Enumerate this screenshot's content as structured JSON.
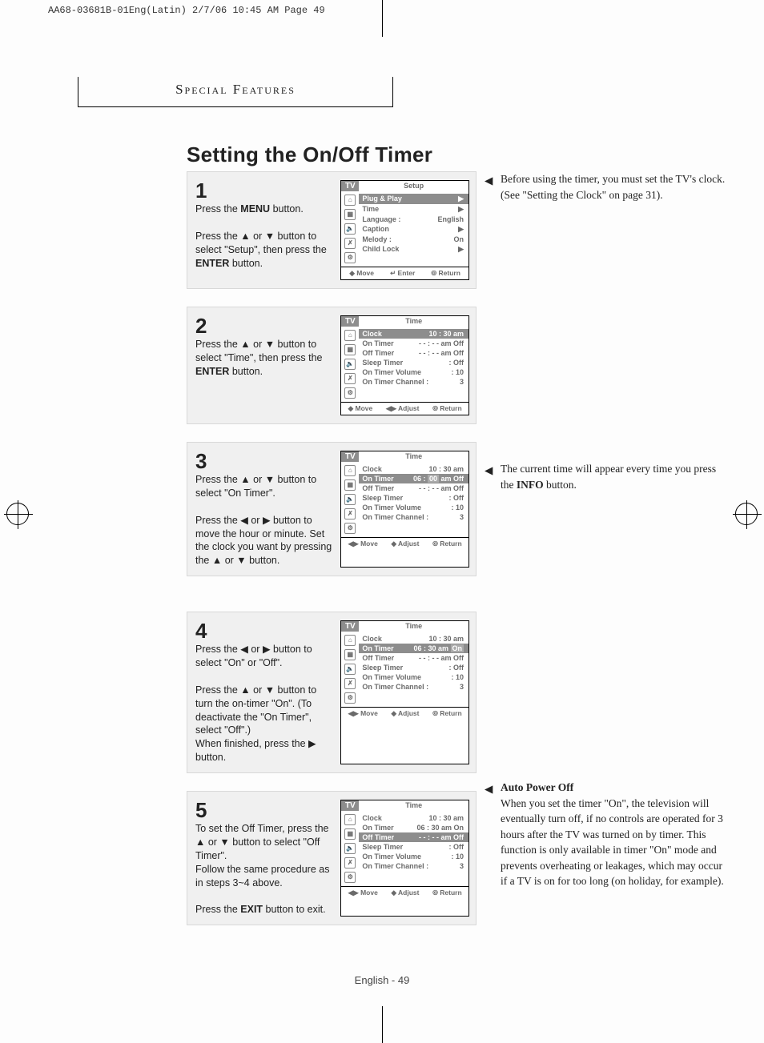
{
  "print_header": "AA68-03681B-01Eng(Latin)  2/7/06  10:45 AM  Page 49",
  "section_header": "Special Features",
  "title": "Setting the On/Off Timer",
  "footer": "English - 49",
  "tri": {
    "up": "▲",
    "down": "▼",
    "left": "◀",
    "right": "▶",
    "lr": "◀▶",
    "ud": "▲▼",
    "enter": "↵",
    "ret": "⦾"
  },
  "sidenotes": {
    "n1": "Before using the timer, you must set the TV's clock. (See \"Setting the Clock\" on page 31).",
    "n2_a": "The current time will appear every time you press the ",
    "n2_info": "INFO",
    "n2_b": " button.",
    "n3_title": "Auto Power Off",
    "n3_body": "When you set the timer \"On\", the television will eventually turn off, if no controls are operated for 3 hours after the TV was turned on by timer. This function is only available in timer \"On\" mode and prevents overheating or leakages, which may occur if a TV is on for too long (on holiday, for example)."
  },
  "steps": [
    {
      "num": "1",
      "text_a": "Press the ",
      "text_menu": "MENU",
      "text_b": " button.",
      "text_c": "Press the ▲ or ▼ button to select \"Setup\", then press the ",
      "text_enter": "ENTER",
      "text_d": " button.",
      "osd": {
        "title": "Setup",
        "foot": [
          "◆ Move",
          "↵ Enter",
          "⦾ Return"
        ],
        "rows": [
          {
            "sel": true,
            "l": "Plug & Play",
            "r": "▶"
          },
          {
            "l": "Time",
            "r": "▶"
          },
          {
            "l": "Language :",
            "r": "English"
          },
          {
            "l": "Caption",
            "r": "▶"
          },
          {
            "l": "Melody    :",
            "r": "On"
          },
          {
            "l": "Child Lock",
            "r": "▶"
          }
        ]
      }
    },
    {
      "num": "2",
      "text_a": "Press the ▲ or ▼ button to select \"Time\", then press the ",
      "text_enter": "ENTER",
      "text_b": " button.",
      "osd": {
        "title": "Time",
        "foot": [
          "◆ Move",
          "◀▶ Adjust",
          "⦾ Return"
        ],
        "rows": [
          {
            "sel": true,
            "l": "Clock",
            "r": "10 : 30 am"
          },
          {
            "l": "On Timer",
            "r": "- - : - - am Off"
          },
          {
            "l": "Off Timer",
            "r": "- - : - - am Off"
          },
          {
            "l": "Sleep Timer",
            "r": ": Off"
          },
          {
            "l": "On Timer Volume",
            "r": ": 10"
          },
          {
            "l": "On Timer Channel :",
            "r": "3"
          }
        ]
      }
    },
    {
      "num": "3",
      "text_a": "Press the ▲ or ▼ button to select \"On Timer\".",
      "text_b": "Press the ◀ or ▶ button to move the hour or minute. Set the clock you want by pressing the ▲ or ▼ button.",
      "osd": {
        "title": "Time",
        "foot": [
          "◀▶ Move",
          "◆ Adjust",
          "⦾ Return"
        ],
        "rows": [
          {
            "l": "Clock",
            "r": "10 : 30 am"
          },
          {
            "sel": true,
            "l": "On Timer",
            "r_html": "06 : <span class='hl'>00</span> am Off"
          },
          {
            "l": "Off Timer",
            "r": "- - : - - am Off"
          },
          {
            "l": "Sleep Timer",
            "r": ": Off"
          },
          {
            "l": "On Timer Volume",
            "r": ": 10"
          },
          {
            "l": "On Timer Channel :",
            "r": "3"
          }
        ]
      }
    },
    {
      "num": "4",
      "text_a": "Press the ◀ or ▶ button to select \"On\" or \"Off\".",
      "text_b": "Press the ▲ or ▼ button to turn the on-timer \"On\". (To deactivate the \"On Timer\", select \"Off\".)",
      "text_c": "When finished, press the ▶ button.",
      "osd": {
        "title": "Time",
        "foot": [
          "◀▶ Move",
          "◆ Adjust",
          "⦾ Return"
        ],
        "rows": [
          {
            "l": "Clock",
            "r": "10 : 30 am"
          },
          {
            "sel": true,
            "l": "On Timer",
            "r_html": "06 : 30 am <span class='hl'>On</span>"
          },
          {
            "l": "Off Timer",
            "r": "- - : - - am Off"
          },
          {
            "l": "Sleep Timer",
            "r": ": Off"
          },
          {
            "l": "On Timer Volume",
            "r": ": 10"
          },
          {
            "l": "On Timer Channel :",
            "r": "3"
          }
        ]
      }
    },
    {
      "num": "5",
      "text_a": "To set the Off Timer, press the ▲ or ▼ button to select \"Off Timer\".",
      "text_b": "Follow the same procedure as in steps 3~4 above.",
      "text_c": "Press the ",
      "text_exit": "EXIT",
      "text_d": " button to exit.",
      "osd": {
        "title": "Time",
        "foot": [
          "◀▶ Move",
          "◆ Adjust",
          "⦾ Return"
        ],
        "rows": [
          {
            "l": "Clock",
            "r": "10 : 30 am"
          },
          {
            "l": "On Timer",
            "r": "06 : 30 am On"
          },
          {
            "sel": true,
            "l": "Off Timer",
            "r": "- - : - - am Off"
          },
          {
            "l": "Sleep Timer",
            "r": ": Off"
          },
          {
            "l": "On Timer Volume",
            "r": ": 10"
          },
          {
            "l": "On Timer Channel :",
            "r": "3"
          }
        ]
      }
    }
  ]
}
